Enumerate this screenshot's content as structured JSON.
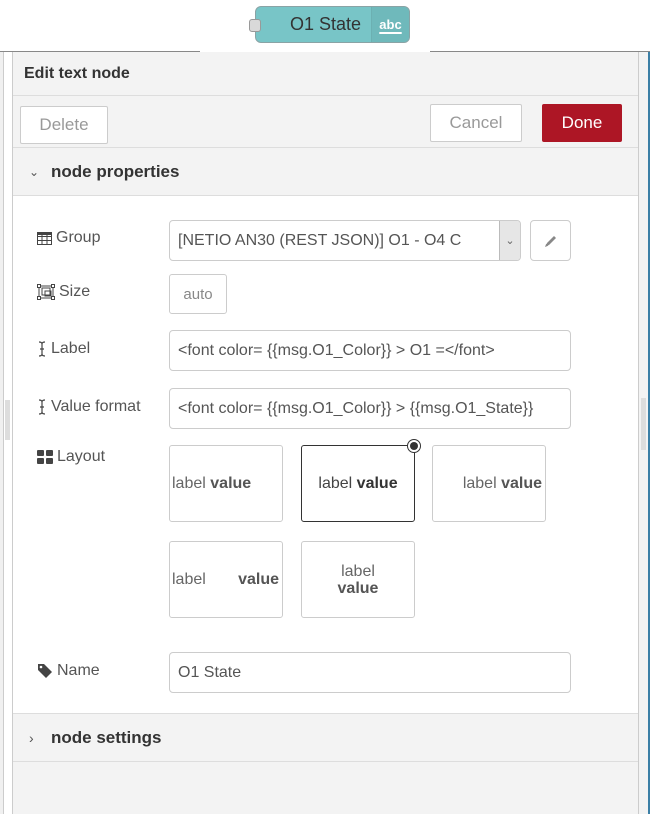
{
  "node": {
    "label": "O1 State",
    "icon": "abc",
    "color": "#78c5c7"
  },
  "tray": {
    "title": "Edit text node",
    "buttons": {
      "delete": "Delete",
      "cancel": "Cancel",
      "done": "Done"
    },
    "accent_color": "#ad1625"
  },
  "sections": {
    "properties": {
      "label": "node properties",
      "expanded": true,
      "chevron": "chevron-down-icon"
    },
    "settings": {
      "label": "node settings",
      "expanded": false,
      "chevron": "chevron-right-icon"
    }
  },
  "form": {
    "group": {
      "label": "Group",
      "icon": "table-icon",
      "value": "[NETIO AN30 (REST JSON)] O1 - O4 C"
    },
    "size": {
      "label": "Size",
      "icon": "object-ungroup-icon",
      "value": "auto"
    },
    "label_field": {
      "label": "Label",
      "icon": "i-cursor-icon",
      "value": "<font color= {{msg.O1_Color}} > O1 =</font>"
    },
    "value_format": {
      "label": "Value format",
      "icon": "i-cursor-icon",
      "value": "<font color= {{msg.O1_Color}} > {{msg.O1_State}}"
    },
    "layout": {
      "label": "Layout",
      "icon": "th-large-icon",
      "selected_index": 1,
      "options": [
        {
          "label": "label",
          "value": "value",
          "arrangement": "row-left"
        },
        {
          "label": "label",
          "value": "value",
          "arrangement": "row-center"
        },
        {
          "label": "label",
          "value": "value",
          "arrangement": "row-right"
        },
        {
          "label": "label",
          "value": "value",
          "arrangement": "row-spread"
        },
        {
          "label": "label",
          "value": "value",
          "arrangement": "column-center"
        }
      ]
    },
    "name": {
      "label": "Name",
      "icon": "tag-icon",
      "value": "O1 State"
    }
  }
}
